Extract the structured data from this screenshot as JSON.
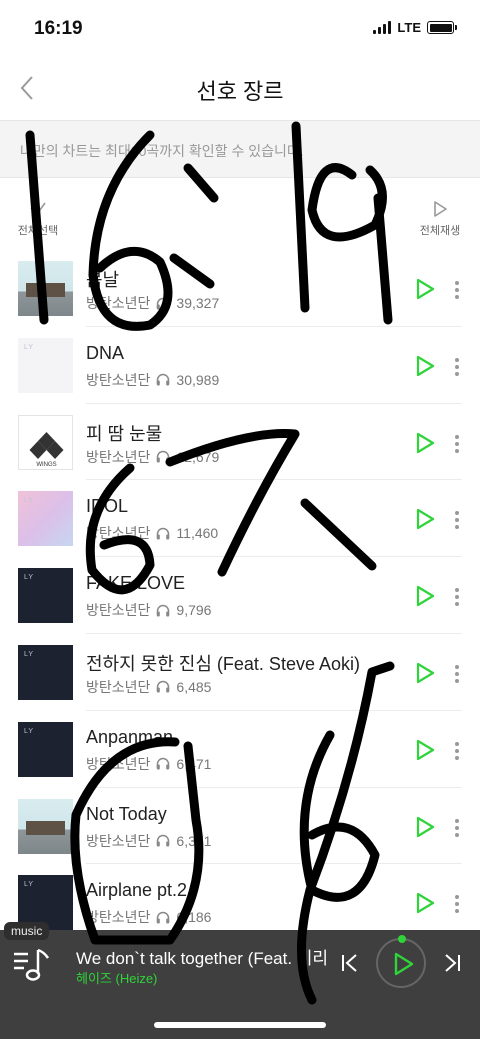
{
  "status_bar": {
    "time": "16:19",
    "network": "LTE"
  },
  "nav": {
    "title": "선호 장르"
  },
  "notice": {
    "text": "나만의 차트는 최대30곡까지 확인할 수 있습니다."
  },
  "controls": {
    "select_all_label": "전체선택",
    "play_all_label": "전체재생"
  },
  "songs": [
    {
      "title": "봄날",
      "artist": "방탄소년단",
      "plays": "39,327",
      "cover": "thumb-sky"
    },
    {
      "title": "DNA",
      "artist": "방탄소년단",
      "plays": "30,989",
      "cover": "thumb-white"
    },
    {
      "title": "피 땀 눈물",
      "artist": "방탄소년단",
      "plays": "12,679",
      "cover": "thumb-wings"
    },
    {
      "title": "IDOL",
      "artist": "방탄소년단",
      "plays": "11,460",
      "cover": "thumb-pink"
    },
    {
      "title": "FAKE LOVE",
      "artist": "방탄소년단",
      "plays": "9,796",
      "cover": "thumb-navy"
    },
    {
      "title": "전하지 못한 진심 (Feat. Steve Aoki)",
      "artist": "방탄소년단",
      "plays": "6,485",
      "cover": "thumb-navy"
    },
    {
      "title": "Anpanman",
      "artist": "방탄소년단",
      "plays": "6,471",
      "cover": "thumb-navy"
    },
    {
      "title": "Not Today",
      "artist": "방탄소년단",
      "plays": "6,371",
      "cover": "thumb-sky"
    },
    {
      "title": "Airplane pt.2",
      "artist": "방탄소년단",
      "plays": "6,186",
      "cover": "thumb-navy"
    }
  ],
  "album_labels": {
    "wings": "WINGS",
    "ly": "LY"
  },
  "player": {
    "badge": "music",
    "now_title": "We don`t talk together (Feat. 기리보이) (Prod. SUGA)",
    "now_artist": "헤이즈 (Heize)"
  },
  "handwriting": {
    "line1": "16:19",
    "line2": "6/7 ~",
    "line3": "ᆨ6"
  },
  "colors": {
    "accent_green": "#2fd33a",
    "player_bg": "#3f3f3f",
    "notice_bg": "#f4f4f4"
  },
  "icons": [
    "back-chevron-icon",
    "check-icon",
    "play-outline-icon",
    "headphones-icon",
    "more-vertical-icon",
    "queue-music-icon",
    "skip-previous-icon",
    "skip-next-icon"
  ]
}
